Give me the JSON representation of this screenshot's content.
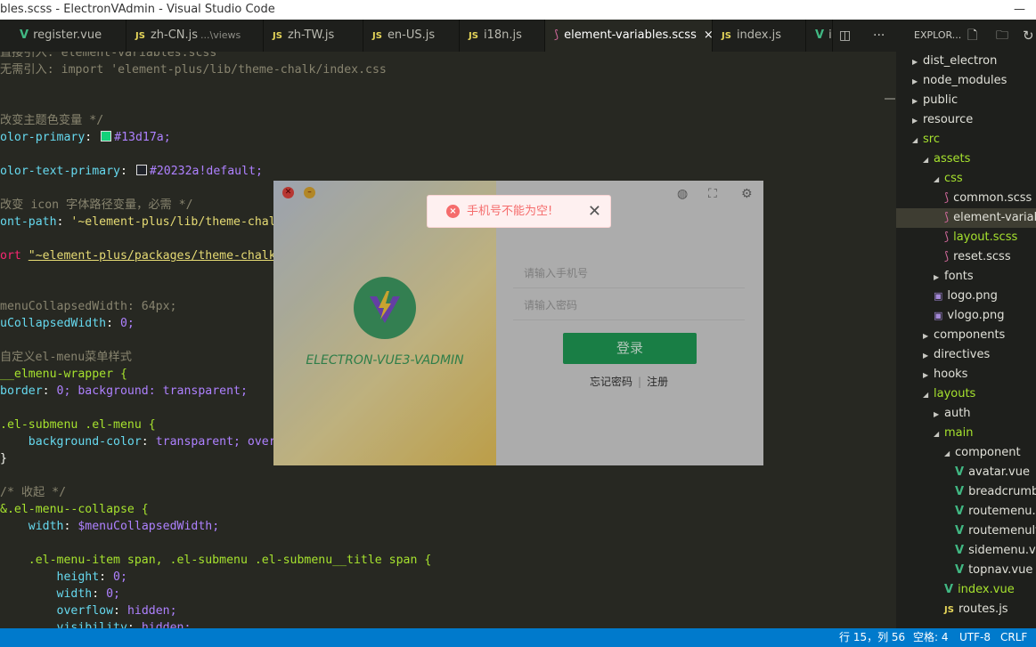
{
  "window": {
    "title": "bles.scss - ElectronVAdmin - Visual Studio Code",
    "minimize_icon": "—"
  },
  "tabs": [
    {
      "icon": "V",
      "label": "register.vue",
      "desc": ""
    },
    {
      "icon": "JS",
      "label": "zh-CN.js",
      "desc": "...\\views"
    },
    {
      "icon": "JS",
      "label": "zh-TW.js",
      "desc": ""
    },
    {
      "icon": "JS",
      "label": "en-US.js",
      "desc": ""
    },
    {
      "icon": "JS",
      "label": "i18n.js",
      "desc": ""
    },
    {
      "icon": "scss",
      "label": "element-variables.scss",
      "desc": "",
      "close": "×"
    },
    {
      "icon": "JS",
      "label": "index.js",
      "desc": ""
    },
    {
      "icon": "V",
      "label": "i",
      "desc": ""
    }
  ],
  "tab_actions": {
    "split": "◫",
    "more": "···"
  },
  "code": [
    {
      "type": "cm",
      "text": "直接引入: element-variables.scss"
    },
    {
      "type": "cm",
      "text": "无需引入: import 'element-plus/lib/theme-chalk/index.css"
    },
    {
      "type": "blank",
      "text": ""
    },
    {
      "type": "blank",
      "text": ""
    },
    {
      "type": "cm",
      "text": "改变主题色变量 */"
    },
    {
      "type": "var",
      "prop": "olor-primary",
      "swatch": "#13d17a",
      "value": "#13d17a;"
    },
    {
      "type": "blank",
      "text": ""
    },
    {
      "type": "var",
      "prop": "olor-text-primary",
      "swatch": "#20232a",
      "value": "#20232a!default;"
    },
    {
      "type": "blank",
      "text": ""
    },
    {
      "type": "cm",
      "text": "改变 icon 字体路径变量，必需 */"
    },
    {
      "type": "str",
      "prop": "ont-path",
      "value": "'~element-plus/lib/theme-chalk"
    },
    {
      "type": "blank",
      "text": ""
    },
    {
      "type": "import",
      "kw": "ort",
      "value": "\"~element-plus/packages/theme-chalk/"
    },
    {
      "type": "blank",
      "text": ""
    },
    {
      "type": "blank",
      "text": ""
    },
    {
      "type": "cm",
      "text": "menuCollapsedWidth: 64px;"
    },
    {
      "type": "plain",
      "prop": "uCollapsedWidth",
      "value": "0;"
    },
    {
      "type": "blank",
      "text": ""
    },
    {
      "type": "cm",
      "text": "自定义el-menu菜单样式"
    },
    {
      "type": "sel",
      "text": "__elmenu-wrapper {"
    },
    {
      "type": "decl",
      "prop": "border",
      "value": "0; background: transparent;"
    },
    {
      "type": "blank",
      "text": ""
    },
    {
      "type": "sel",
      "text": ".el-submenu .el-menu {"
    },
    {
      "type": "decl",
      "prop": "    background-color",
      "value": "transparent; overf"
    },
    {
      "type": "plain2",
      "text": "}"
    },
    {
      "type": "blank",
      "text": ""
    },
    {
      "type": "cm",
      "text": "/* 收起 */"
    },
    {
      "type": "sel",
      "text": "&.el-menu--collapse {"
    },
    {
      "type": "decl",
      "prop": "    width",
      "value": "$menuCollapsedWidth;"
    },
    {
      "type": "blank",
      "text": ""
    },
    {
      "type": "sel",
      "text": "    .el-menu-item span, .el-submenu .el-submenu__title span {"
    },
    {
      "type": "decl",
      "prop": "        height",
      "value": "0;"
    },
    {
      "type": "decl",
      "prop": "        width",
      "value": "0;"
    },
    {
      "type": "decl",
      "prop": "        overflow",
      "value": "hidden;"
    },
    {
      "type": "decl",
      "prop": "        visibility",
      "value": "hidden;"
    }
  ],
  "explorer": {
    "header": "EXPLOR...",
    "items": [
      {
        "label": "dist_electron",
        "kind": "folder",
        "open": false,
        "depth": 0
      },
      {
        "label": "node_modules",
        "kind": "folder",
        "open": false,
        "depth": 0
      },
      {
        "label": "public",
        "kind": "folder",
        "open": false,
        "depth": 0
      },
      {
        "label": "resource",
        "kind": "folder",
        "open": false,
        "depth": 0
      },
      {
        "label": "src",
        "kind": "folder",
        "open": true,
        "depth": 0,
        "green": true
      },
      {
        "label": "assets",
        "kind": "folder",
        "open": true,
        "depth": 1,
        "green": true
      },
      {
        "label": "css",
        "kind": "folder",
        "open": true,
        "depth": 2,
        "green": true
      },
      {
        "label": "common.scss",
        "kind": "scss",
        "depth": 3
      },
      {
        "label": "element-variab",
        "kind": "scss",
        "depth": 3,
        "selected": true
      },
      {
        "label": "layout.scss",
        "kind": "scss",
        "depth": 3,
        "green": true
      },
      {
        "label": "reset.scss",
        "kind": "scss",
        "depth": 3
      },
      {
        "label": "fonts",
        "kind": "folder",
        "open": false,
        "depth": 2
      },
      {
        "label": "logo.png",
        "kind": "png",
        "depth": 2
      },
      {
        "label": "vlogo.png",
        "kind": "png",
        "depth": 2
      },
      {
        "label": "components",
        "kind": "folder",
        "open": false,
        "depth": 1
      },
      {
        "label": "directives",
        "kind": "folder",
        "open": false,
        "depth": 1
      },
      {
        "label": "hooks",
        "kind": "folder",
        "open": false,
        "depth": 1
      },
      {
        "label": "layouts",
        "kind": "folder",
        "open": true,
        "depth": 1,
        "green": true
      },
      {
        "label": "auth",
        "kind": "folder",
        "open": false,
        "depth": 2
      },
      {
        "label": "main",
        "kind": "folder",
        "open": true,
        "depth": 2,
        "green": true
      },
      {
        "label": "component",
        "kind": "folder",
        "open": true,
        "depth": 3
      },
      {
        "label": "avatar.vue",
        "kind": "vue",
        "depth": 4
      },
      {
        "label": "breadcrumb.v",
        "kind": "vue",
        "depth": 4
      },
      {
        "label": "routemenu.vu",
        "kind": "vue",
        "depth": 4
      },
      {
        "label": "routemenulte",
        "kind": "vue",
        "depth": 4
      },
      {
        "label": "sidemenu.vue",
        "kind": "vue",
        "depth": 4
      },
      {
        "label": "topnav.vue",
        "kind": "vue",
        "depth": 4
      },
      {
        "label": "index.vue",
        "kind": "vue",
        "depth": 3,
        "green": true
      },
      {
        "label": "routes.js",
        "kind": "js",
        "depth": 3
      }
    ]
  },
  "login": {
    "brand": "ELECTRON-VUE3-VADMIN",
    "phone_placeholder": "请输入手机号",
    "password_placeholder": "请输入密码",
    "login_button": "登录",
    "forgot": "忘记密码",
    "sep": "|",
    "register": "注册"
  },
  "toast": {
    "message": "手机号不能为空!",
    "icon": "×",
    "close": "✕"
  },
  "status": {
    "position": "行 15，列 56",
    "spaces": "空格: 4",
    "encoding": "UTF-8",
    "eol": "CRLF"
  },
  "colors": {
    "accent": "#007acc",
    "primary": "#13d17a",
    "error": "#f56c6c"
  }
}
